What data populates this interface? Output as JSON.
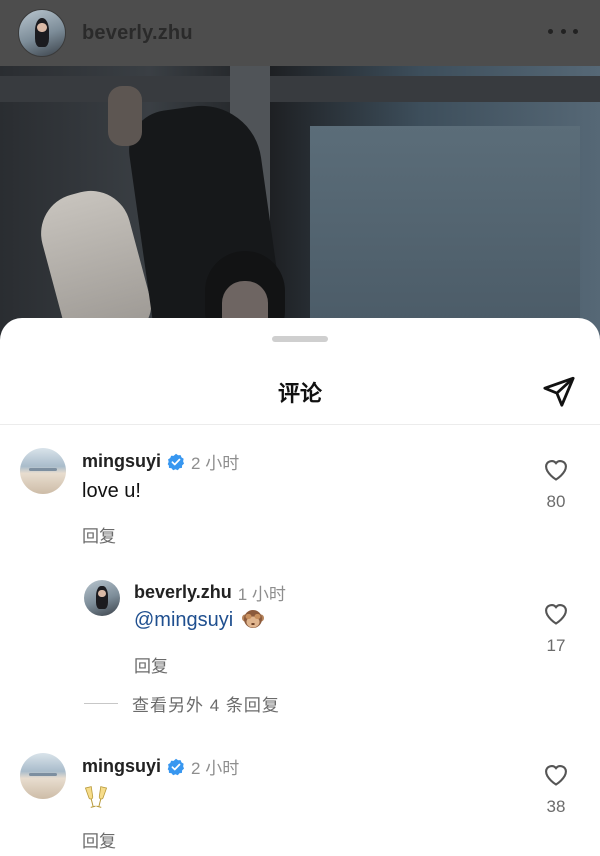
{
  "post": {
    "username": "beverly.zhu",
    "more_icon": "more-horizontal-icon"
  },
  "sheet": {
    "title": "评论",
    "share_icon": "send-icon"
  },
  "comments": [
    {
      "username": "mingsuyi",
      "verified": true,
      "time": "2 小时",
      "text": "love u!",
      "reply_label": "回复",
      "likes": "80"
    },
    {
      "username": "beverly.zhu",
      "verified": false,
      "time": "1 小时",
      "mention": "@mingsuyi",
      "emoji": "see-no-evil-monkey",
      "reply_label": "回复",
      "likes": "17"
    },
    {
      "username": "mingsuyi",
      "verified": true,
      "time": "2 小时",
      "emoji": "clinking-glasses",
      "reply_label": "回复",
      "likes": "38"
    }
  ],
  "more_replies": "查看另外 4 条回复",
  "colors": {
    "verified": "#3897f0",
    "mention": "#1f4f8f",
    "secondary_text": "#6b6b6b"
  }
}
